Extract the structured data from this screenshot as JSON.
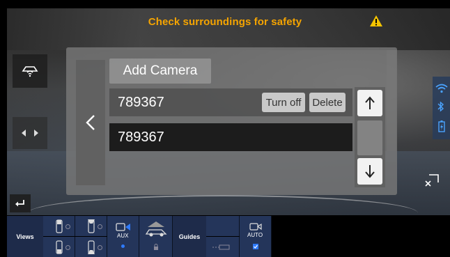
{
  "warning": {
    "text": "Check surroundings for safety",
    "icon": "warning-triangle-icon",
    "color": "#f5a400"
  },
  "panel": {
    "add_label": "Add Camera",
    "rows": [
      {
        "name": "789367",
        "turn_off": "Turn off",
        "delete": "Delete"
      },
      {
        "name": "789367"
      }
    ]
  },
  "bottom": {
    "views_label": "Views",
    "guides_label": "Guides",
    "aux_label": "AUX",
    "auto_label": "AUTO"
  },
  "colors": {
    "accent": "#2f7bff",
    "panel": "#787878",
    "bar": "#24355a"
  }
}
